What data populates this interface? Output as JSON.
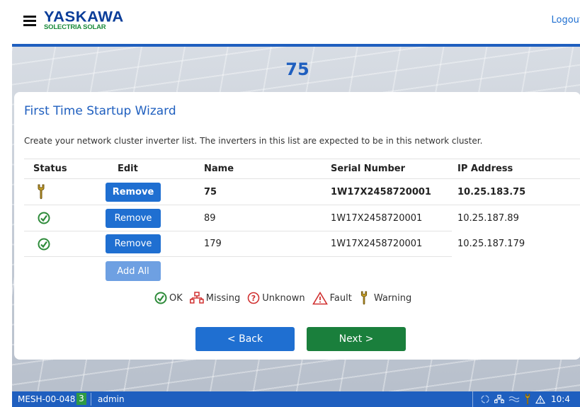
{
  "header": {
    "logo_main": "YASKAWA",
    "logo_sub": "SOLECTRIA SOLAR",
    "logout_label": "Logout"
  },
  "banner": {
    "title": "75"
  },
  "wizard": {
    "title": "First Time Startup Wizard",
    "instructions": "Create your network cluster inverter list. The inverters in this list are expected to be in this network cluster."
  },
  "table": {
    "headers": [
      "Status",
      "Edit",
      "Name",
      "Serial Number",
      "IP Address"
    ],
    "rows": [
      {
        "status": "warning",
        "edit_label": "Remove",
        "name": "75",
        "serial": "1W17X2458720001",
        "ip": "10.25.183.75"
      },
      {
        "status": "ok",
        "edit_label": "Remove",
        "name": "89",
        "serial": "1W17X2458720001",
        "ip": "10.25.187.89"
      },
      {
        "status": "ok",
        "edit_label": "Remove",
        "name": "179",
        "serial": "1W17X2458720001",
        "ip": "10.25.187.179"
      }
    ],
    "add_all_label": "Add All"
  },
  "legend": {
    "ok": "OK",
    "missing": "Missing",
    "unknown": "Unknown",
    "fault": "Fault",
    "warning": "Warning"
  },
  "nav": {
    "back_label": "< Back",
    "next_label": "Next >"
  },
  "statusbar": {
    "device": "MESH-00-048",
    "badge": "3",
    "user": "admin",
    "time": "10:4"
  },
  "colors": {
    "brand_blue": "#1f5fbf",
    "button_blue": "#1f6fd1",
    "next_green": "#1a7f3c",
    "ok_green": "#2e8b3a",
    "fault_red": "#d03030",
    "warning_gold": "#b8860b"
  }
}
